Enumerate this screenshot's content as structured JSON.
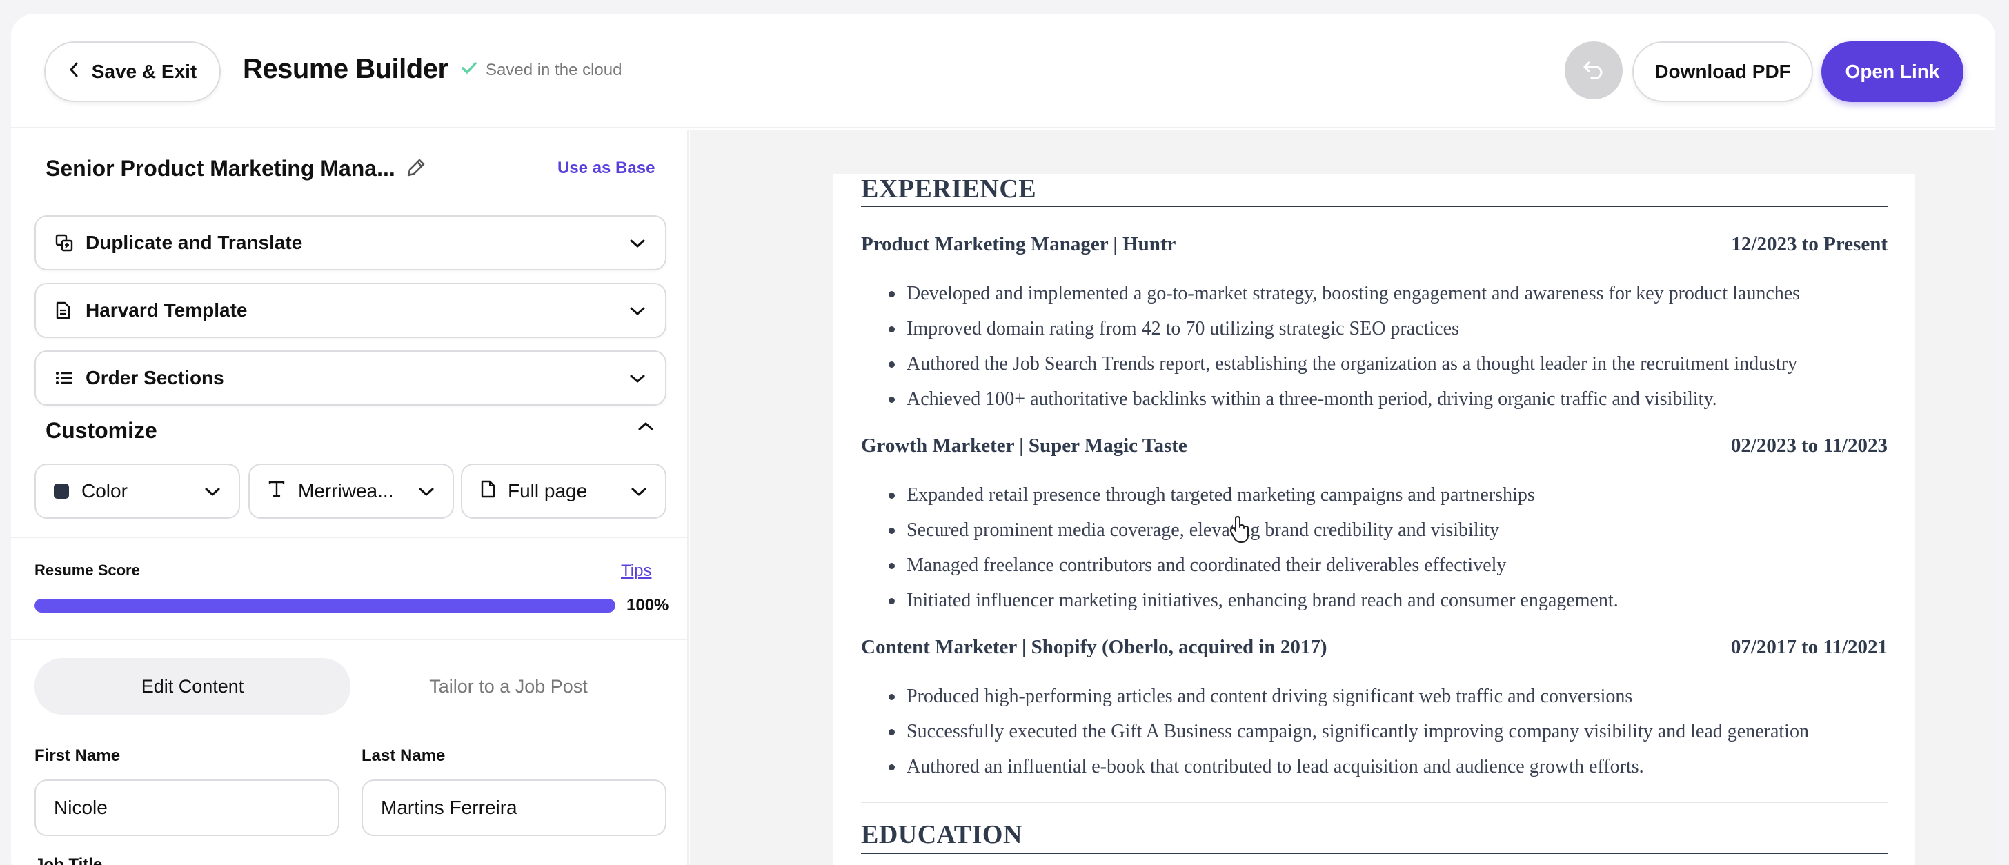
{
  "header": {
    "save_exit_label": "Save & Exit",
    "app_title": "Resume Builder",
    "saved_status": "Saved in the cloud",
    "download_label": "Download PDF",
    "open_link_label": "Open Link"
  },
  "sidebar": {
    "resume_name": "Senior Product Marketing Mana...",
    "use_as_base": "Use as Base",
    "accordions": [
      {
        "label": "Duplicate and Translate",
        "icon": "translate-icon"
      },
      {
        "label": "Harvard Template",
        "icon": "document-icon"
      },
      {
        "label": "Order Sections",
        "icon": "list-icon"
      }
    ],
    "customize_label": "Customize",
    "color_label": "Color",
    "font_label": "Merriwea...",
    "page_label": "Full page",
    "swatch_color": "#2b3445",
    "score": {
      "label": "Resume Score",
      "tips": "Tips",
      "value": 1.0,
      "display": "100%"
    },
    "tabs": [
      "Edit Content",
      "Tailor to a Job Post"
    ],
    "fields": {
      "first_name_label": "First Name",
      "first_name_value": "Nicole",
      "last_name_label": "Last Name",
      "last_name_value": "Martins Ferreira",
      "job_title_label": "Job Title"
    }
  },
  "preview": {
    "experience_title": "EXPERIENCE",
    "jobs": [
      {
        "title": "Product Marketing Manager | Huntr",
        "dates": "12/2023 to Present",
        "bullets": [
          "Developed and implemented a go-to-market strategy, boosting engagement and awareness for key product launches",
          "Improved domain rating from 42 to 70 utilizing strategic SEO practices",
          "Authored the Job Search Trends report, establishing the organization as a thought leader in the recruitment industry",
          "Achieved 100+ authoritative backlinks within a three-month period, driving organic traffic and visibility."
        ]
      },
      {
        "title": "Growth Marketer | Super Magic Taste",
        "dates": "02/2023 to 11/2023",
        "bullets": [
          "Expanded retail presence through targeted marketing campaigns and partnerships",
          "Secured prominent media coverage, elevating brand credibility and visibility",
          "Managed freelance contributors and coordinated their deliverables effectively",
          "Initiated influencer marketing initiatives, enhancing brand reach and consumer engagement."
        ]
      },
      {
        "title": "Content Marketer | Shopify (Oberlo, acquired in 2017)",
        "dates": "07/2017 to 11/2021",
        "bullets": [
          "Produced high-performing articles and content driving significant web traffic and conversions",
          "Successfully executed the Gift A Business campaign, significantly improving company visibility and lead generation",
          "Authored an influential e-book that contributed to lead acquisition and audience growth efforts."
        ]
      }
    ],
    "education_title": "EDUCATION"
  }
}
